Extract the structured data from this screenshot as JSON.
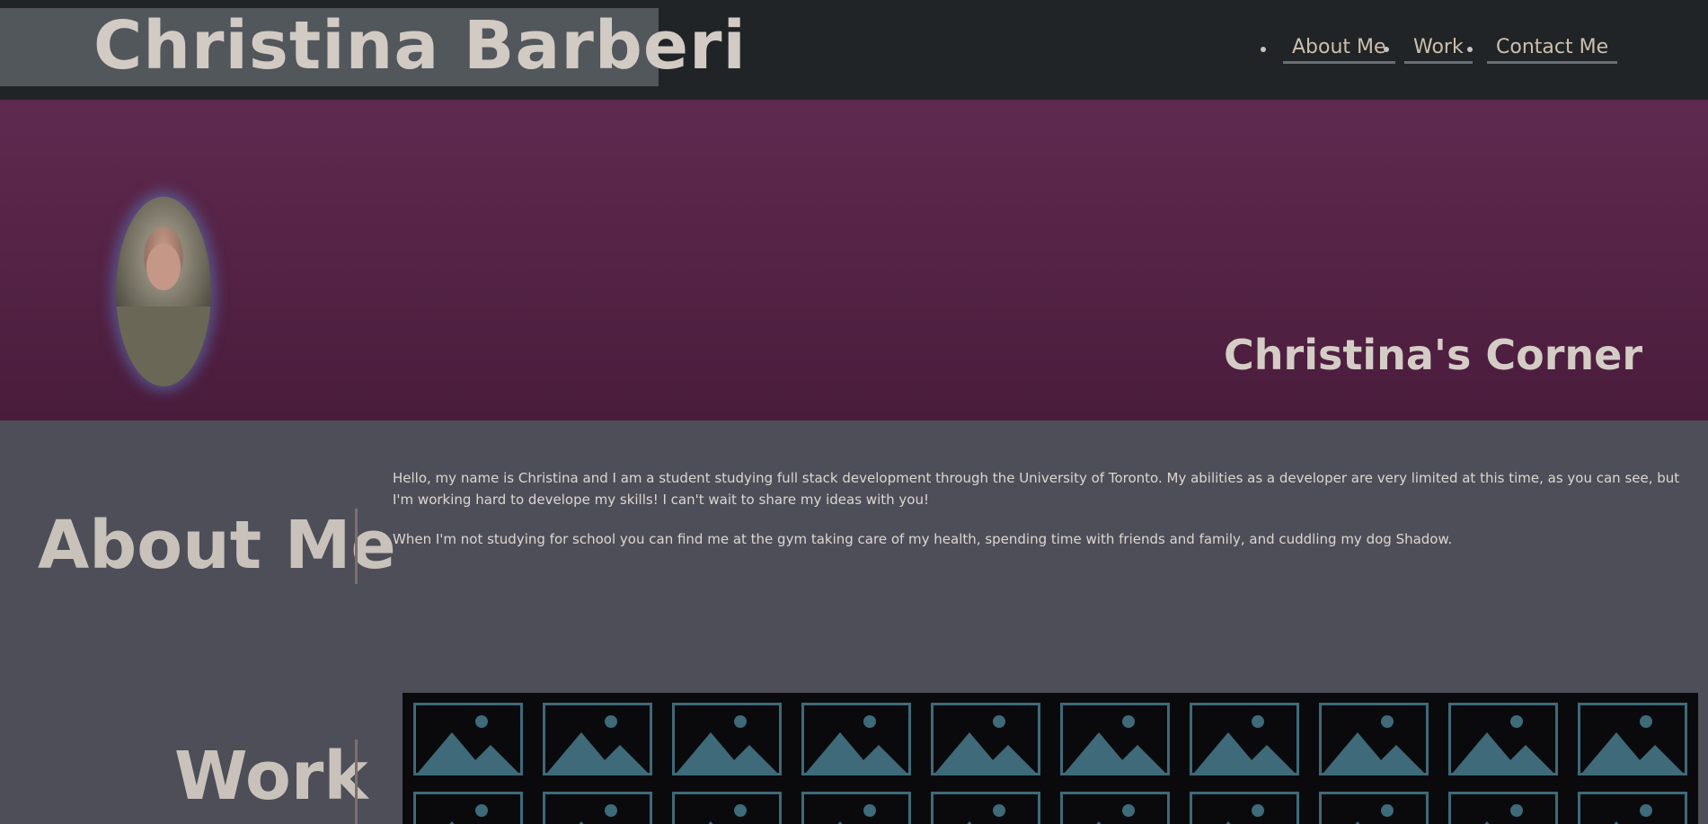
{
  "header": {
    "site_title": "Christina Barberi",
    "nav": [
      {
        "label": "About Me"
      },
      {
        "label": "Work"
      },
      {
        "label": "Contact Me"
      }
    ]
  },
  "hero": {
    "title": "Christina's Corner",
    "avatar_icon": "profile-photo"
  },
  "about": {
    "heading": "About Me",
    "paragraphs": [
      "Hello, my name is Christina and I am a student studying full stack development through the University of Toronto. My abilities as a developer are very limited at this time, as you can see, but I'm working hard to develope my skills! I can't wait to share my ideas with you!",
      "When I'm not studying for school you can find me at the gym taking care of my health, spending time with friends and family, and cuddling my dog Shadow."
    ]
  },
  "work": {
    "heading": "Work",
    "thumbnail_icon": "image-placeholder-icon"
  },
  "colors": {
    "header_bg": "#212426",
    "hero_top": "#5f2a4f",
    "hero_bottom": "#4a1c3c",
    "page_bg": "#4d4e58",
    "thumbnail_accent": "#3e6a79"
  }
}
